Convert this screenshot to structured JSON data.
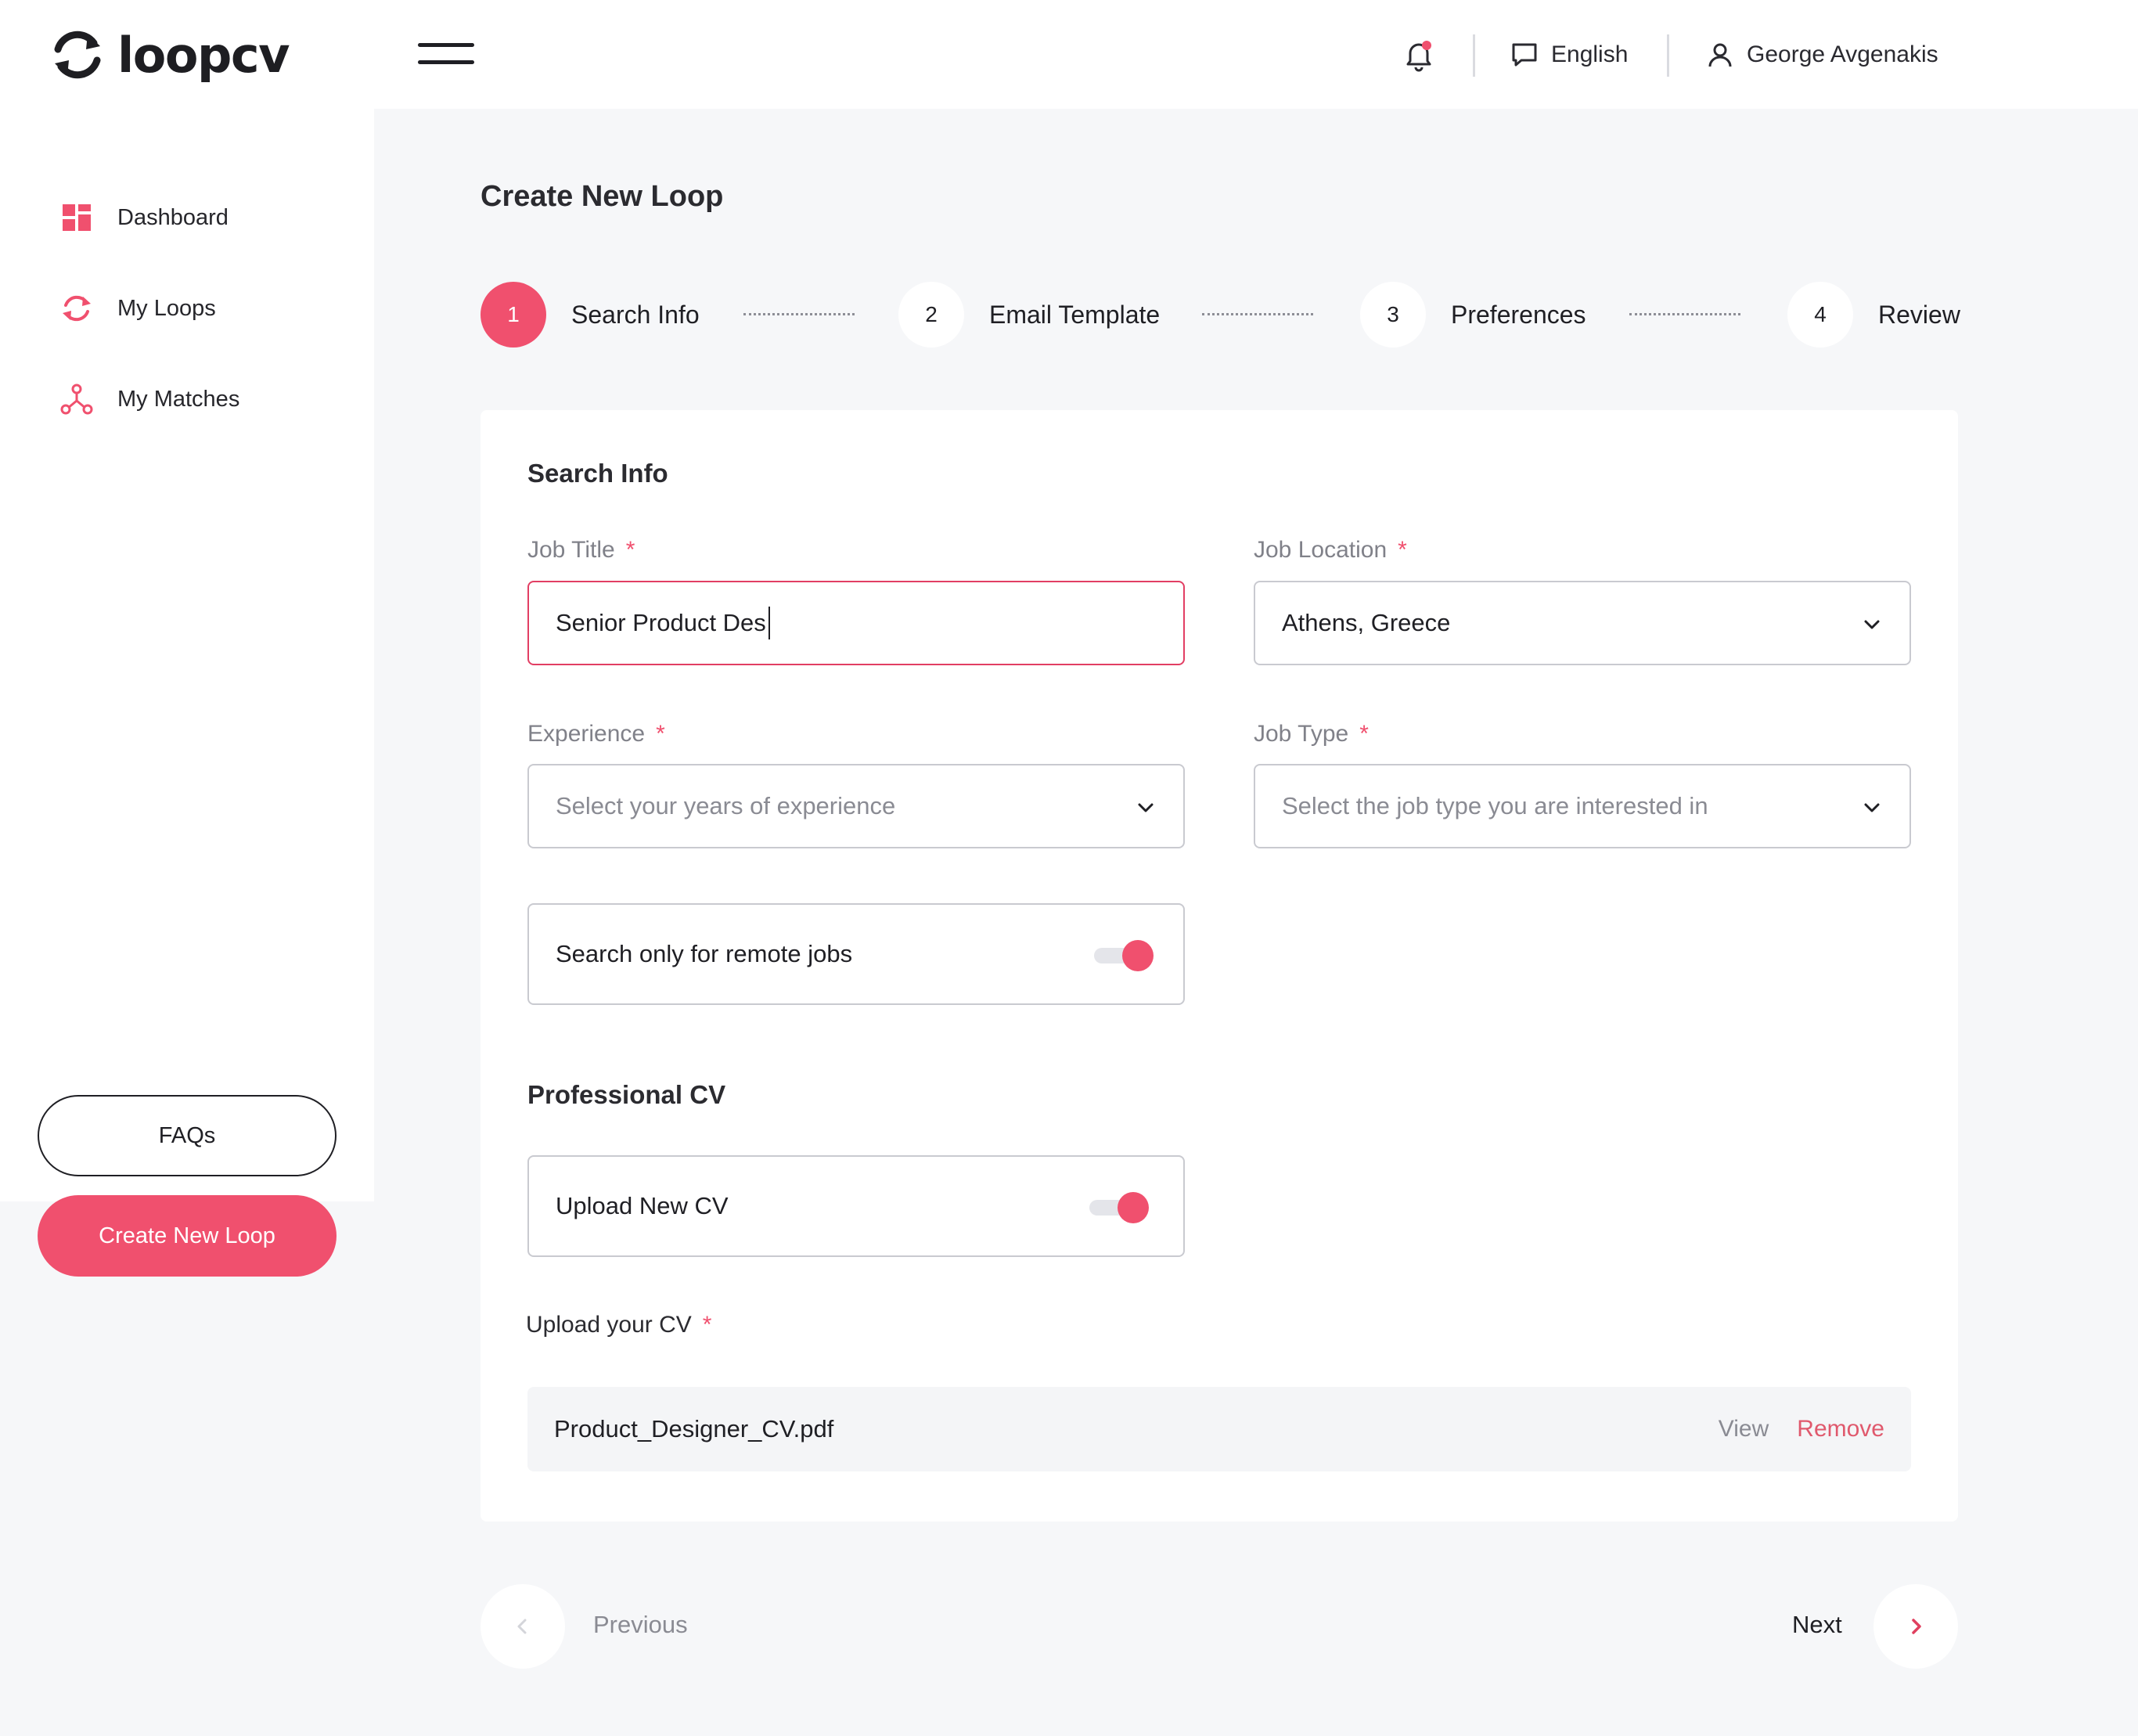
{
  "app": {
    "brand": "loopcv"
  },
  "header": {
    "language": "English",
    "user_name": "George Avgenakis"
  },
  "sidebar": {
    "items": [
      {
        "label": "Dashboard",
        "icon": "dashboard-icon"
      },
      {
        "label": "My Loops",
        "icon": "loop-icon"
      },
      {
        "label": "My Matches",
        "icon": "matches-icon"
      }
    ],
    "faq_label": "FAQs",
    "create_label": "Create New Loop"
  },
  "page": {
    "title": "Create New Loop",
    "steps": [
      {
        "number": "1",
        "label": "Search Info",
        "active": true
      },
      {
        "number": "2",
        "label": "Email Template",
        "active": false
      },
      {
        "number": "3",
        "label": "Preferences",
        "active": false
      },
      {
        "number": "4",
        "label": "Review",
        "active": false
      }
    ]
  },
  "form": {
    "section_title": "Search Info",
    "job_title": {
      "label": "Job Title",
      "value": "Senior Product Des"
    },
    "job_location": {
      "label": "Job Location",
      "value": "Athens, Greece"
    },
    "experience": {
      "label": "Experience",
      "placeholder": "Select your years of experience"
    },
    "job_type": {
      "label": "Job Type",
      "placeholder": "Select the job type you are interested in"
    },
    "remote": {
      "label": "Search only for remote jobs",
      "enabled": true
    },
    "required_mark": "*"
  },
  "cv": {
    "section_title": "Professional CV",
    "upload_toggle": {
      "label": "Upload New CV",
      "enabled": true
    },
    "upload_label": "Upload your CV",
    "file_name": "Product_Designer_CV.pdf",
    "view_label": "View",
    "remove_label": "Remove"
  },
  "pager": {
    "previous_label": "Previous",
    "next_label": "Next"
  },
  "colors": {
    "accent": "#f0506e",
    "background": "#f6f7f9",
    "text": "#1f1f24",
    "muted": "#808189"
  }
}
